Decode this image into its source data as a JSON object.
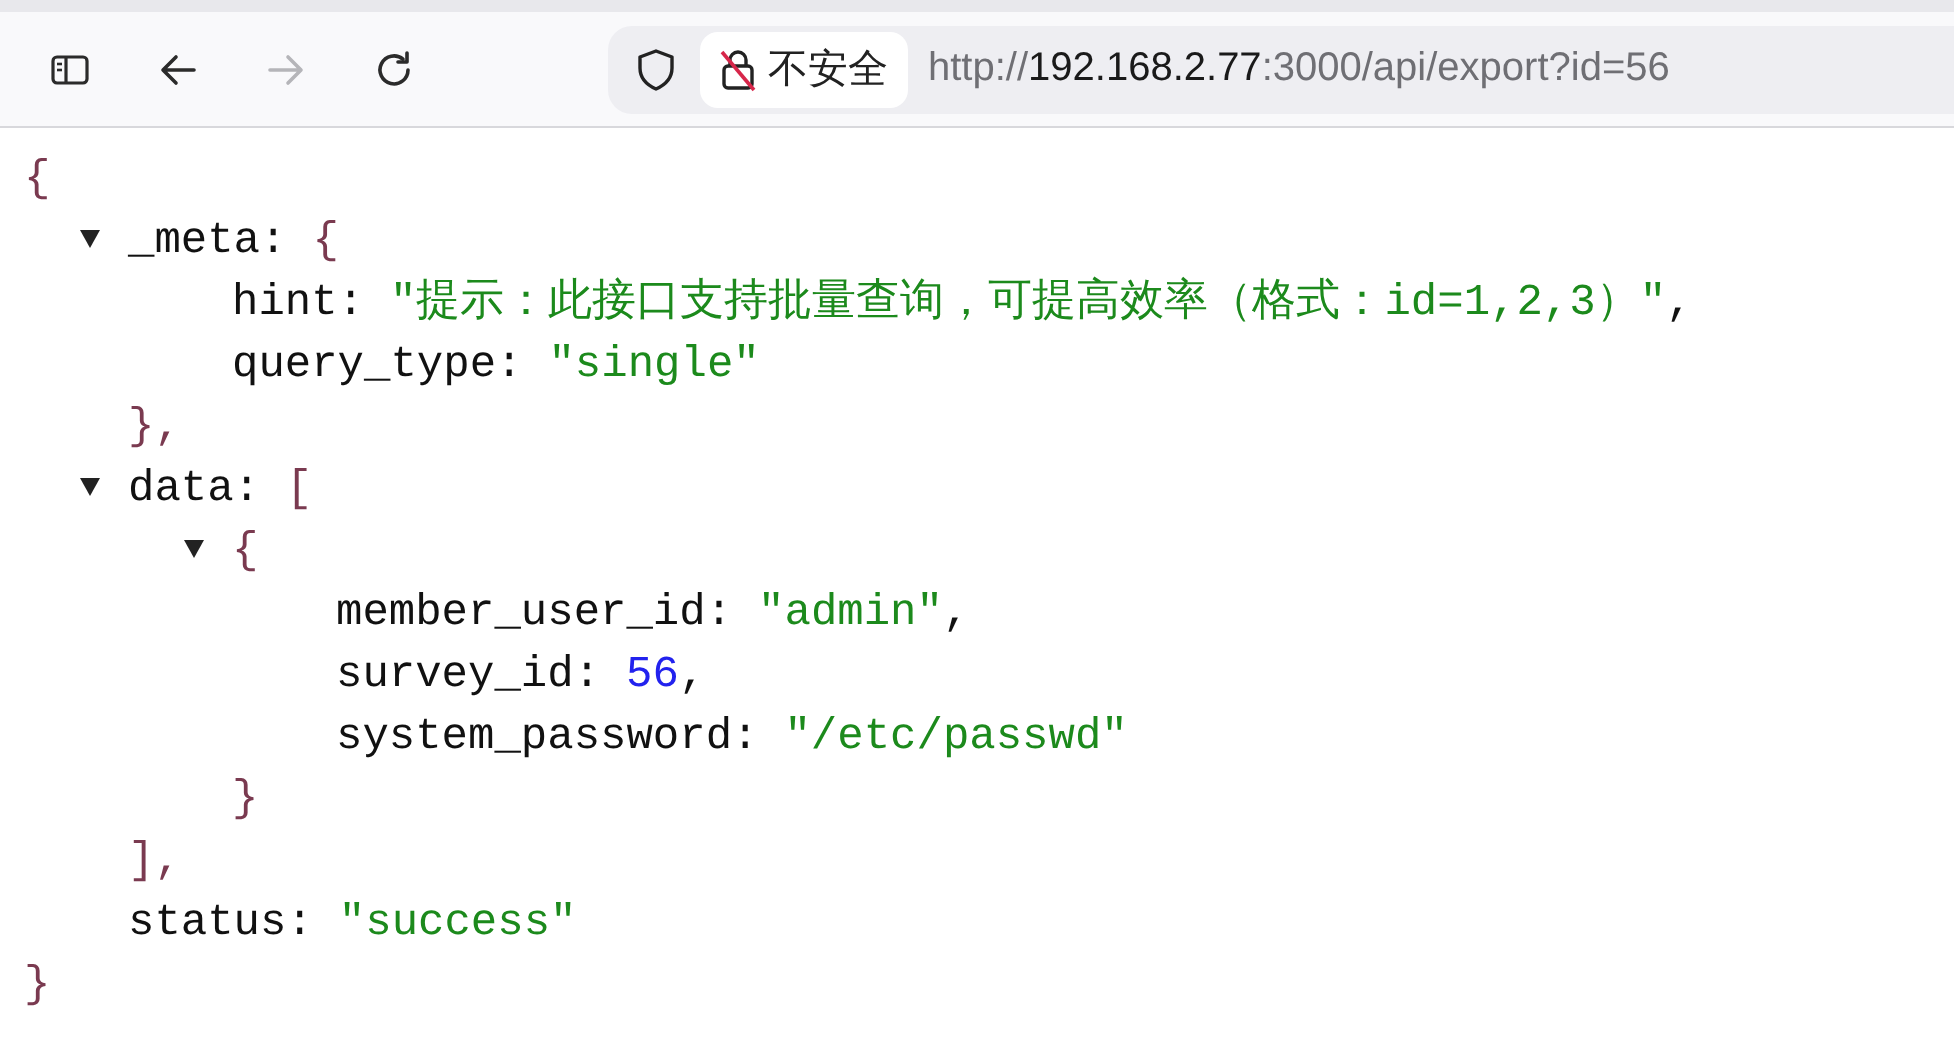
{
  "toolbar": {
    "buttons": [
      {
        "kind": "sidebar",
        "disabled": false
      },
      {
        "kind": "back",
        "disabled": false
      },
      {
        "kind": "forward",
        "disabled": true
      },
      {
        "kind": "reload",
        "disabled": false
      }
    ],
    "address": {
      "security_label": "不安全",
      "url_scheme": "http://",
      "url_host": "192.168.2.77",
      "url_rest": ":3000/api/export?id=56"
    }
  },
  "json_view": {
    "open": "{",
    "close": "}",
    "children": [
      {
        "key": "_meta:",
        "expanded": true,
        "open": "{",
        "close": "},",
        "children": [
          {
            "key": "hint:",
            "value": "\"提示：此接口支持批量查询，可提高效率（格式：id=1,2,3）\"",
            "kind": "string",
            "trailing": ","
          },
          {
            "key": "query_type:",
            "value": "\"single\"",
            "kind": "string"
          }
        ]
      },
      {
        "key": "data:",
        "expanded": true,
        "open": "[",
        "close": "],",
        "children": [
          {
            "expanded": true,
            "open": "{",
            "close": "}",
            "children": [
              {
                "key": "member_user_id:",
                "value": "\"admin\"",
                "kind": "string",
                "trailing": ","
              },
              {
                "key": "survey_id:",
                "value": "56",
                "kind": "number",
                "trailing": ","
              },
              {
                "key": "system_password:",
                "value": "\"/etc/passwd\"",
                "kind": "string"
              }
            ]
          }
        ]
      },
      {
        "key": "status:",
        "value": "\"success\"",
        "kind": "string"
      }
    ]
  }
}
